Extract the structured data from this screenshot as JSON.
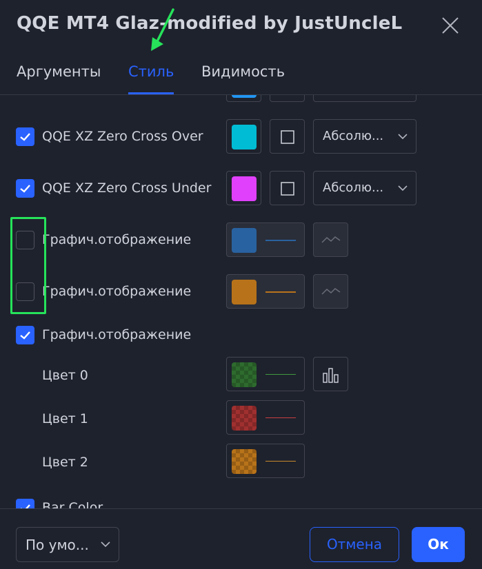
{
  "dialog": {
    "title": "QQE MT4 Glaz-modified by JustUncleL"
  },
  "tabs": [
    {
      "label": "Аргументы",
      "active": false
    },
    {
      "label": "Стиль",
      "active": true
    },
    {
      "label": "Видимость",
      "active": false
    }
  ],
  "rows": {
    "zero_cross_over": {
      "label": "QQE XZ Zero Cross Over",
      "checked": true,
      "color": "#00bcd4",
      "mode": "Абсолю..."
    },
    "zero_cross_under": {
      "label": "QQE XZ Zero Cross Under",
      "checked": true,
      "color": "#e040fb",
      "mode": "Абсолю..."
    },
    "plot1": {
      "label": "Графич.отображение",
      "checked": false,
      "color": "#2962a0"
    },
    "plot2": {
      "label": "Графич.отображение",
      "checked": false,
      "color": "#b8731a"
    },
    "plot3": {
      "label": "Графич.отображение",
      "checked": true
    },
    "color0": {
      "label": "Цвет 0",
      "color": "#2e6b2e"
    },
    "color1": {
      "label": "Цвет 1",
      "color": "#a03030"
    },
    "color2": {
      "label": "Цвет 2",
      "color": "#b8731a"
    },
    "bar_color": {
      "label": "Bar Color",
      "checked": true
    }
  },
  "footer": {
    "template_label": "По умо...",
    "cancel_label": "Отмена",
    "ok_label": "Ок"
  },
  "colors": {
    "accent": "#2962ff",
    "background": "#1e222d",
    "highlight": "#26e35a"
  }
}
